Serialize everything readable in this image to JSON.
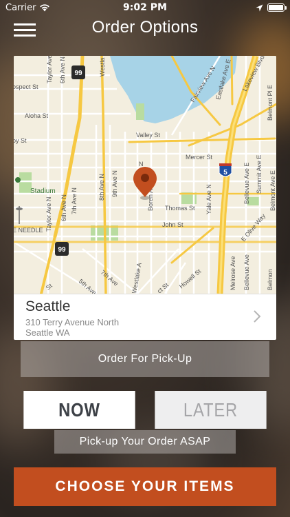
{
  "status_bar": {
    "carrier": "Carrier",
    "time": "9:02 PM",
    "icons": [
      "wifi-icon",
      "location-arrow-icon",
      "battery-icon"
    ],
    "battery_level": 1.0
  },
  "header": {
    "title": "Order Options",
    "menu_icon": "hamburger-menu-icon"
  },
  "map": {
    "labels": {
      "prospect": "ospect St",
      "aloha": "Aloha St",
      "roy": "oy St",
      "valley": "Valley St",
      "mercer": "Mercer St",
      "thomas": "Thomas St",
      "john": "John St",
      "stadium": "Stadium",
      "needle": "E NEEDLE",
      "taylor_top": "Taylor Ave N",
      "taylor_bottom": "Taylor Ave N",
      "sixth_top": "6th Ave N",
      "sixth_bottom": "6th Ave N",
      "seventh": "7th Ave N",
      "eighth": "8th Ave N",
      "ninth": "9th Ave N",
      "boren": "Boren Ave",
      "yale": "Yale Ave N",
      "westlake_top": "Westla",
      "westlake_bottom": "Westlake A",
      "fairview": "Fairview Ave N",
      "eastlake": "Eastlake Ave E",
      "lakeview": "Lakeview Blvd E",
      "belmont_pl": "Belmont Pl E",
      "bellevue": "Bellevue Ave E",
      "summit": "Summit Ave E",
      "belmont_ave": "Belmont Ave E",
      "e_olive": "E Olive Way",
      "melrose": "Melrose Ave",
      "bellevue_ave": "Bellevue Ave",
      "belmon": "Belmon",
      "seventh_ave": "7th Ave",
      "fifth_ave": "5th Ave",
      "st_bottom": "St",
      "howell": "Howell St",
      "ct_st": "ct St",
      "sign_99": "99",
      "sign_5": "5",
      "n_label": "N"
    },
    "colors": {
      "water": "#a7d3e7",
      "land": "#f3eedf",
      "highway": "#f6c842",
      "park": "#b9dca0",
      "pin": "#c24e1f"
    },
    "pin_icon": "map-pin-icon"
  },
  "location": {
    "name": "Seattle",
    "address_line1": "310 Terry Avenue North",
    "address_line2": "Seattle WA",
    "chevron_icon": "chevron-right-icon"
  },
  "order_type": {
    "label": "Order For Pick-Up"
  },
  "timing": {
    "options": [
      "NOW",
      "LATER"
    ],
    "selected": "NOW",
    "description": "Pick-up Your Order ASAP"
  },
  "cta": {
    "label": "CHOOSE YOUR ITEMS",
    "color": "#c24e1f"
  }
}
